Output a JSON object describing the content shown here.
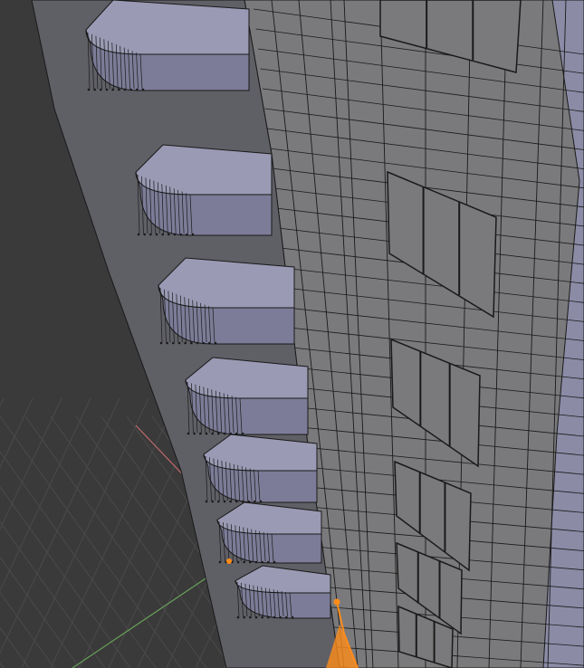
{
  "viewport": {
    "mode": "edit-mode-wireframe-overlay",
    "background_color": "#3a3a3a"
  },
  "colors": {
    "grid": "#4a4a4a",
    "x_axis": "#c06a6a",
    "y_axis": "#6aa05a",
    "mesh_face_main": "#7a7a7c",
    "mesh_face_shadow": "#5f5f66",
    "balcony_face": "#9a9ab4",
    "balcony_face_dark": "#7c7c98",
    "side_face": "#8b8ba6",
    "wire": "#1a1a1a",
    "vertex_selected": "#ff8c1a",
    "edge_selected": "#ff8c1a"
  },
  "scene": {
    "object": "building-mesh",
    "balcony_count": 7,
    "window_count": 6
  }
}
